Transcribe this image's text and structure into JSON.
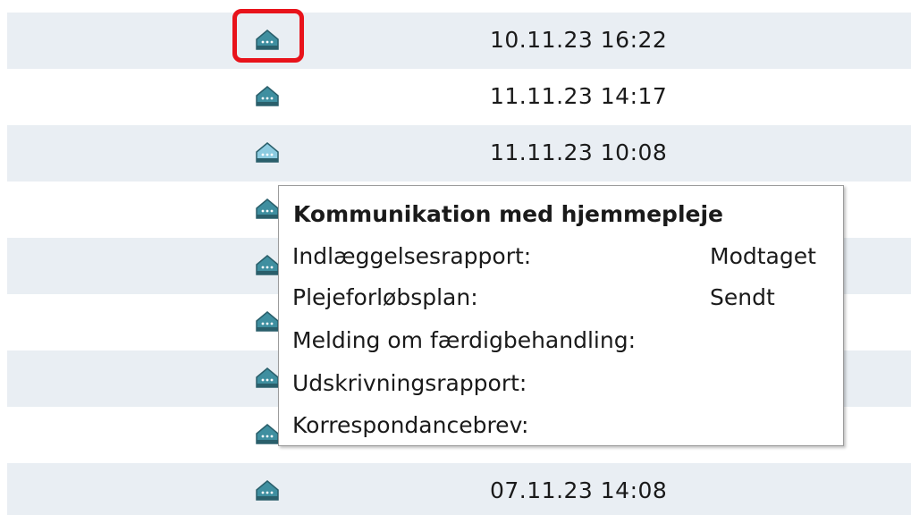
{
  "rows": [
    {
      "date": "10.11.23 16:22",
      "icon": "house-icon",
      "icon_color": "#3f8fa0"
    },
    {
      "date": "11.11.23 14:17",
      "icon": "house-icon",
      "icon_color": "#3f8fa0"
    },
    {
      "date": "11.11.23 10:08",
      "icon": "house-icon",
      "icon_color": "#8ccbe0"
    },
    {
      "date": "",
      "icon": "house-icon",
      "icon_color": "#3f8fa0"
    },
    {
      "date": "",
      "icon": "house-icon",
      "icon_color": "#3f8fa0"
    },
    {
      "date": "",
      "icon": "house-icon",
      "icon_color": "#3f8fa0"
    },
    {
      "date": "",
      "icon": "house-icon",
      "icon_color": "#3f8fa0"
    },
    {
      "date": "",
      "icon": "house-icon",
      "icon_color": "#3f8fa0"
    },
    {
      "date": "07.11.23 14:08",
      "icon": "house-icon",
      "icon_color": "#3f8fa0"
    }
  ],
  "tooltip": {
    "title": "Kommunikation med hjemmepleje",
    "items": [
      {
        "label": "Indlæggelsesrapport:",
        "value": "Modtaget"
      },
      {
        "label": "Plejeforløbsplan:",
        "value": "Sendt"
      },
      {
        "label": "Melding om færdigbehandling:",
        "value": ""
      },
      {
        "label": "Udskrivningsrapport:",
        "value": ""
      },
      {
        "label": "Korrespondancebrev:",
        "value": ""
      }
    ]
  },
  "colors": {
    "alt_row": "#e9eef3",
    "highlight": "#e8131b",
    "icon_dark": "#3f8fa0",
    "icon_light": "#8ccbe0"
  }
}
